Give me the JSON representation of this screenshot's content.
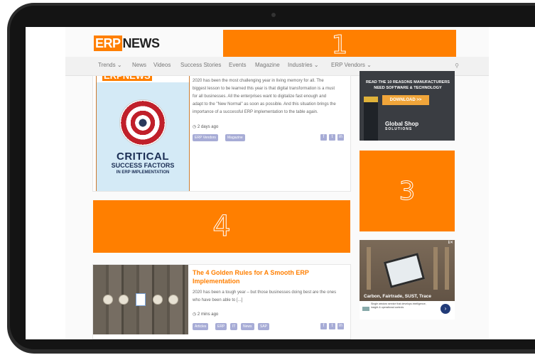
{
  "site": {
    "logo_erp": "ERP",
    "logo_news": "NEWS"
  },
  "nav": {
    "items": [
      "Trends ⌄",
      "News",
      "Videos",
      "Success Stories",
      "Events",
      "Magazine",
      "Industries ⌄",
      "ERP Vendors ⌄"
    ],
    "search_icon": "search-icon"
  },
  "ad_slots": [
    "1",
    "3",
    "4"
  ],
  "article1": {
    "cover_brand": "ERPNEWS",
    "cover_title": "CRITICAL",
    "cover_subtitle": "SUCCESS FACTORS",
    "cover_subtitle2": "IN ERP IMPLEMENTATION",
    "excerpt": [
      "2020 has been the most challenging year in living memory for all. The",
      "biggest lesson to be learned this year is that digital transformation is a must",
      "for all businesses. All the enterprises want to digitalize fast enough and",
      "adapt to the \"New Normal\" as soon as possible.  And this situation brings the",
      "importance of a successful ERP implementation to the table again."
    ],
    "time": "2 days ago",
    "tags": [
      "ERP Vendors",
      "Magazine"
    ]
  },
  "article2": {
    "title_line1": "The 4 Golden Rules for A Smooth ERP",
    "title_line2": "Implementation",
    "excerpt": [
      "2020 has been a tough year – but those businesses doing best are the ones",
      "who have been able to [...]"
    ],
    "time": "2 mins ago",
    "tags": [
      "Articles",
      "ERP",
      "IT",
      "News",
      "SAP"
    ]
  },
  "share": {
    "facebook": "f",
    "twitter": "t",
    "linkedin": "in"
  },
  "gs_ad": {
    "headline_1": "READ THE 10 REASONS MANUFACTURERS",
    "headline_2": "NEED SOFTWARE & TECHNOLOGY",
    "button": "DOWNLOAD >>",
    "logo": "Global Shop",
    "logo_sub": "SOLUTIONS"
  },
  "ware_ad": {
    "headline": "Carbon, Fairtrade, SUST, Trace",
    "body": "Single window service that develops intelligence, insight & operational controls",
    "arrow": "›",
    "corner": "ℹ✕"
  },
  "colors": {
    "accent": "#ff7f00",
    "tag": "#a7acd6"
  }
}
